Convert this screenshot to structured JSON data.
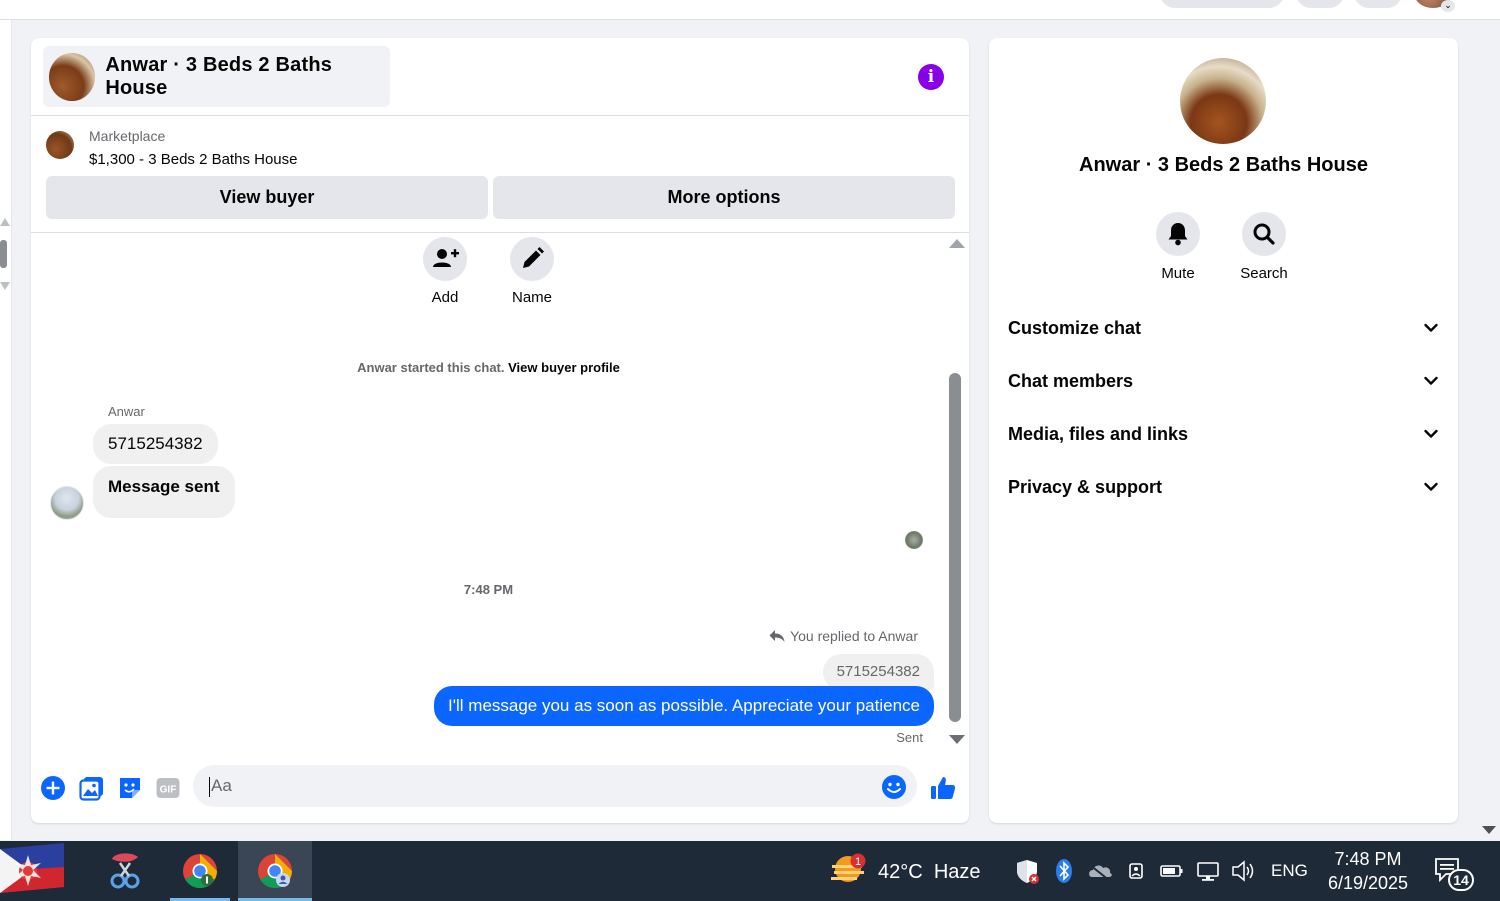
{
  "chat": {
    "title": "Anwar · 3 Beds 2 Baths House",
    "listing": {
      "category": "Marketplace",
      "price_title": "$1,300 - 3 Beds 2 Baths House"
    },
    "view_buyer_label": "View buyer",
    "more_options_label": "More options",
    "actions": {
      "add_label": "Add",
      "name_label": "Name"
    },
    "system_message": {
      "text": "Anwar started this chat.",
      "link": "View buyer profile"
    },
    "incoming": {
      "sender": "Anwar",
      "messages": [
        "5715254382",
        "Message sent"
      ]
    },
    "timestamp": "7:48 PM",
    "reply_note": "You replied to Anwar",
    "quoted_text": "5715254382",
    "outgoing_text": "I'll message you as soon as possible. Appreciate your patience",
    "status": "Sent",
    "composer": {
      "placeholder": "Aa"
    },
    "accent_color": "#0a66ff"
  },
  "info_panel": {
    "title": "Anwar · 3 Beds 2 Baths House",
    "mute_label": "Mute",
    "search_label": "Search",
    "sections": [
      {
        "label": "Customize chat"
      },
      {
        "label": "Chat members"
      },
      {
        "label": "Media, files and links"
      },
      {
        "label": "Privacy & support"
      }
    ]
  },
  "taskbar": {
    "weather_temp": "42°C",
    "weather_cond": "Haze",
    "weather_badge": "1",
    "language": "ENG",
    "time": "7:48 PM",
    "date": "6/19/2025",
    "notifications": "14"
  }
}
